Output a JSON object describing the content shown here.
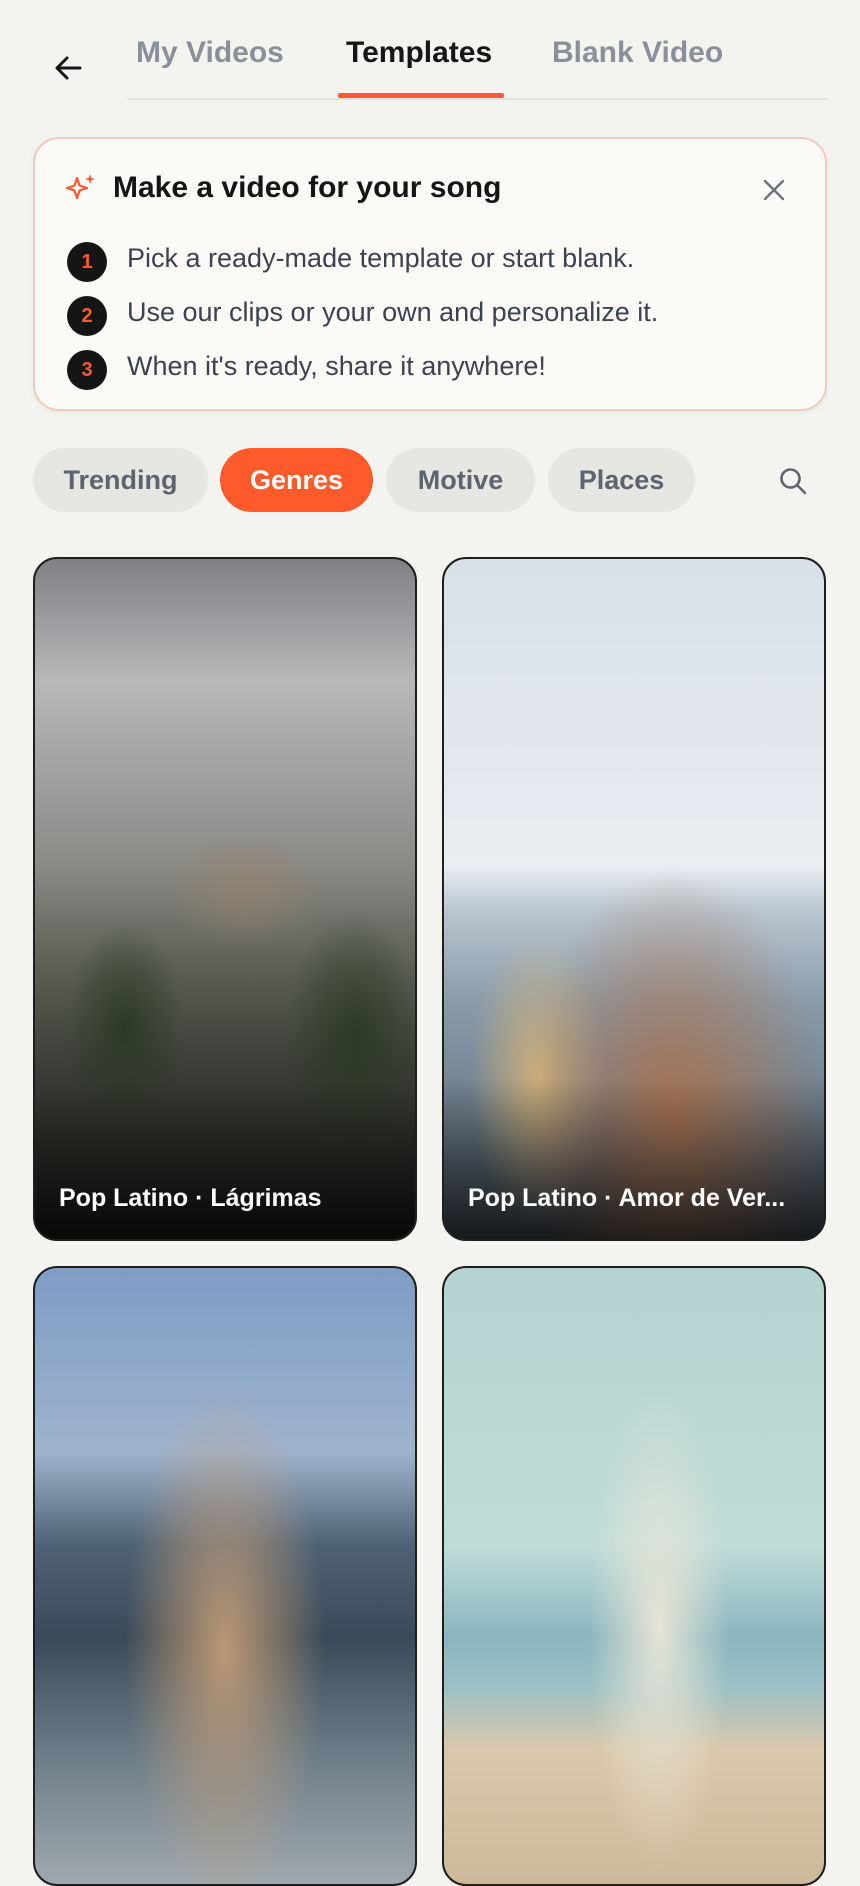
{
  "header": {
    "tabs": [
      {
        "label": "My Videos",
        "active": false
      },
      {
        "label": "Templates",
        "active": true
      },
      {
        "label": "Blank Video",
        "active": false
      }
    ]
  },
  "info_card": {
    "title": "Make a video for your song",
    "steps": [
      {
        "number": "1",
        "text": "Pick a ready-made template or start blank."
      },
      {
        "number": "2",
        "text": "Use our clips or your own and personalize it."
      },
      {
        "number": "3",
        "text": "When it's ready, share it anywhere!"
      }
    ]
  },
  "filters": {
    "chips": [
      {
        "label": "Trending",
        "active": false
      },
      {
        "label": "Genres",
        "active": true
      },
      {
        "label": "Motive",
        "active": false
      },
      {
        "label": "Places",
        "active": false
      }
    ]
  },
  "templates": [
    {
      "label": "Pop Latino · Lágrimas"
    },
    {
      "label": "Pop Latino · Amor de Ver..."
    },
    {
      "label": ""
    },
    {
      "label": ""
    }
  ],
  "colors": {
    "accent": "#ff5a2c",
    "background": "#f3f3ef",
    "chip": "#e6e6e2"
  },
  "icons": {
    "back": "arrow-left-icon",
    "sparkle": "sparkle-icon",
    "close": "close-icon",
    "search": "search-icon"
  }
}
